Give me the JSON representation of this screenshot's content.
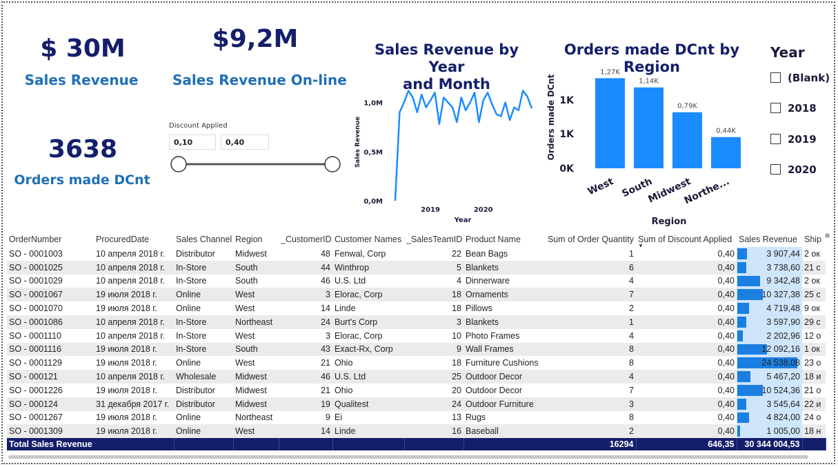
{
  "cards": {
    "sales_revenue": {
      "value": "$ 30M",
      "label": "Sales Revenue"
    },
    "sales_online": {
      "value": "$9,2M",
      "label": "Sales Revenue On-line"
    },
    "orders": {
      "value": "3638",
      "label": "Orders made DCnt"
    }
  },
  "discount_slicer": {
    "title": "Discount Applied",
    "min": "0,10",
    "max": "0,40"
  },
  "line_chart": {
    "title_line1": "Sales Revenue by Year",
    "title_line2": "and Month",
    "ylabel": "Sales Revenue",
    "xlabel": "Year",
    "yticks": [
      "1,0M",
      "0,5M",
      "0,0M"
    ],
    "xticks": [
      "2019",
      "2020"
    ]
  },
  "bar_chart": {
    "title": "Orders made DCnt by Region",
    "ylabel": "Orders made DCnt",
    "xlabel": "Region",
    "yticks": [
      "1K",
      "1K",
      "0K"
    ]
  },
  "year_slicer": {
    "title": "Year",
    "items": [
      "(Blank)",
      "2018",
      "2019",
      "2020"
    ]
  },
  "table": {
    "headers": [
      "OrderNumber",
      "ProcuredDate",
      "Sales Channel",
      "Region",
      "_CustomerID",
      "Customer Names",
      "_SalesTeamID",
      "Product Name",
      "Sum of Order Quantity",
      "Sum of Discount Applied",
      "Sales Revenue",
      "Ship"
    ],
    "rows": [
      [
        "SO - 0001003",
        "10 апреля 2018 г.",
        "Distributor",
        "Midwest",
        "48",
        "Fenwal, Corp",
        "22",
        "Bean Bags",
        "1",
        "0,40",
        "3 907,44",
        "2 ок"
      ],
      [
        "SO - 0001025",
        "10 апреля 2018 г.",
        "In-Store",
        "South",
        "44",
        "Winthrop",
        "5",
        "Blankets",
        "6",
        "0,40",
        "3 738,60",
        "21 с"
      ],
      [
        "SO - 0001029",
        "10 апреля 2018 г.",
        "In-Store",
        "South",
        "46",
        "U.S. Ltd",
        "4",
        "Dinnerware",
        "4",
        "0,40",
        "9 342,48",
        "2 ок"
      ],
      [
        "SO - 0001067",
        "19 июля 2018 г.",
        "Online",
        "West",
        "3",
        "Elorac, Corp",
        "18",
        "Ornaments",
        "7",
        "0,40",
        "10 327,38",
        "25 с"
      ],
      [
        "SO - 0001070",
        "19 июля 2018 г.",
        "Online",
        "West",
        "14",
        "Linde",
        "18",
        "Pillows",
        "2",
        "0,40",
        "4 719,48",
        "9 ок"
      ],
      [
        "SO - 0001086",
        "10 апреля 2018 г.",
        "In-Store",
        "Northeast",
        "24",
        "Burt's Corp",
        "3",
        "Blankets",
        "1",
        "0,40",
        "3 597,90",
        "29 с"
      ],
      [
        "SO - 0001110",
        "10 апреля 2018 г.",
        "In-Store",
        "West",
        "3",
        "Elorac, Corp",
        "10",
        "Photo Frames",
        "4",
        "0,40",
        "2 202,96",
        "12 о"
      ],
      [
        "SO - 0001116",
        "19 июля 2018 г.",
        "In-Store",
        "South",
        "43",
        "Exact-Rx, Corp",
        "9",
        "Wall Frames",
        "8",
        "0,40",
        "12 092,16",
        "1 ок"
      ],
      [
        "SO - 0001129",
        "19 июля 2018 г.",
        "Online",
        "West",
        "21",
        "Ohio",
        "18",
        "Furniture Cushions",
        "8",
        "0,40",
        "24 538,08",
        "23 о"
      ],
      [
        "SO - 000121",
        "10 апреля 2018 г.",
        "Wholesale",
        "Midwest",
        "46",
        "U.S. Ltd",
        "25",
        "Outdoor Decor",
        "4",
        "0,40",
        "5 467,20",
        "18 и"
      ],
      [
        "SO - 0001226",
        "19 июля 2018 г.",
        "Distributor",
        "Midwest",
        "21",
        "Ohio",
        "20",
        "Outdoor Decor",
        "7",
        "0,40",
        "10 524,36",
        "21 о"
      ],
      [
        "SO - 000124",
        "31 декабря 2017 г.",
        "Distributor",
        "Midwest",
        "19",
        "Qualitest",
        "24",
        "Outdoor Furniture",
        "3",
        "0,40",
        "3 545,64",
        "22 и"
      ],
      [
        "SO - 0001267",
        "19 июля 2018 г.",
        "Online",
        "Northeast",
        "9",
        "Ei",
        "13",
        "Rugs",
        "8",
        "0,40",
        "4 824,00",
        "24 о"
      ],
      [
        "SO - 0001309",
        "19 июля 2018 г.",
        "Online",
        "West",
        "14",
        "Linde",
        "16",
        "Baseball",
        "2",
        "0,40",
        "1 005,00",
        "18 н"
      ]
    ],
    "total": {
      "label": "Total Sales Revenue",
      "quantity": "16294",
      "discount": "646,35",
      "revenue": "30 344 004,53"
    },
    "revenue_values": [
      3907.44,
      3738.6,
      9342.48,
      10327.38,
      4719.48,
      3597.9,
      2202.96,
      12092.16,
      24538.08,
      5467.2,
      10524.36,
      3545.64,
      4824.0,
      1005.0
    ],
    "bar_color": "#1a7fe0"
  },
  "chart_data": [
    {
      "type": "bar",
      "title": "Orders made DCnt by Region",
      "xlabel": "Region",
      "ylabel": "Orders made DCnt",
      "categories": [
        "West",
        "South",
        "Midwest",
        "Northe..."
      ],
      "values": [
        1270,
        1140,
        790,
        440
      ],
      "data_labels": [
        "1,27K",
        "1,14K",
        "0,79K",
        "0,44K"
      ],
      "ylim": [
        0,
        1400
      ],
      "color": "#1a8cff"
    },
    {
      "type": "line",
      "title": "Sales Revenue by Year and Month",
      "xlabel": "Year",
      "ylabel": "Sales Revenue",
      "x": [
        "2018-05",
        "2018-06",
        "2018-07",
        "2018-08",
        "2018-09",
        "2018-10",
        "2018-11",
        "2018-12",
        "2019-01",
        "2019-02",
        "2019-03",
        "2019-04",
        "2019-05",
        "2019-06",
        "2019-07",
        "2019-08",
        "2019-09",
        "2019-10",
        "2019-11",
        "2019-12",
        "2020-01",
        "2020-02",
        "2020-03",
        "2020-04",
        "2020-05",
        "2020-06",
        "2020-07",
        "2020-08",
        "2020-09",
        "2020-10",
        "2020-11",
        "2020-12"
      ],
      "values": [
        0.0,
        0.9,
        1.0,
        1.12,
        1.05,
        0.9,
        1.08,
        0.95,
        1.02,
        1.1,
        0.78,
        1.05,
        1.0,
        0.95,
        0.8,
        1.05,
        0.92,
        1.0,
        1.1,
        0.8,
        1.02,
        1.1,
        0.98,
        0.88,
        0.86,
        1.0,
        0.82,
        0.95,
        0.92,
        1.12,
        1.06,
        0.94
      ],
      "ylim": [
        0,
        1.2
      ],
      "yticks": [
        "0,0M",
        "0,5M",
        "1,0M"
      ],
      "color": "#1a8cff"
    }
  ]
}
